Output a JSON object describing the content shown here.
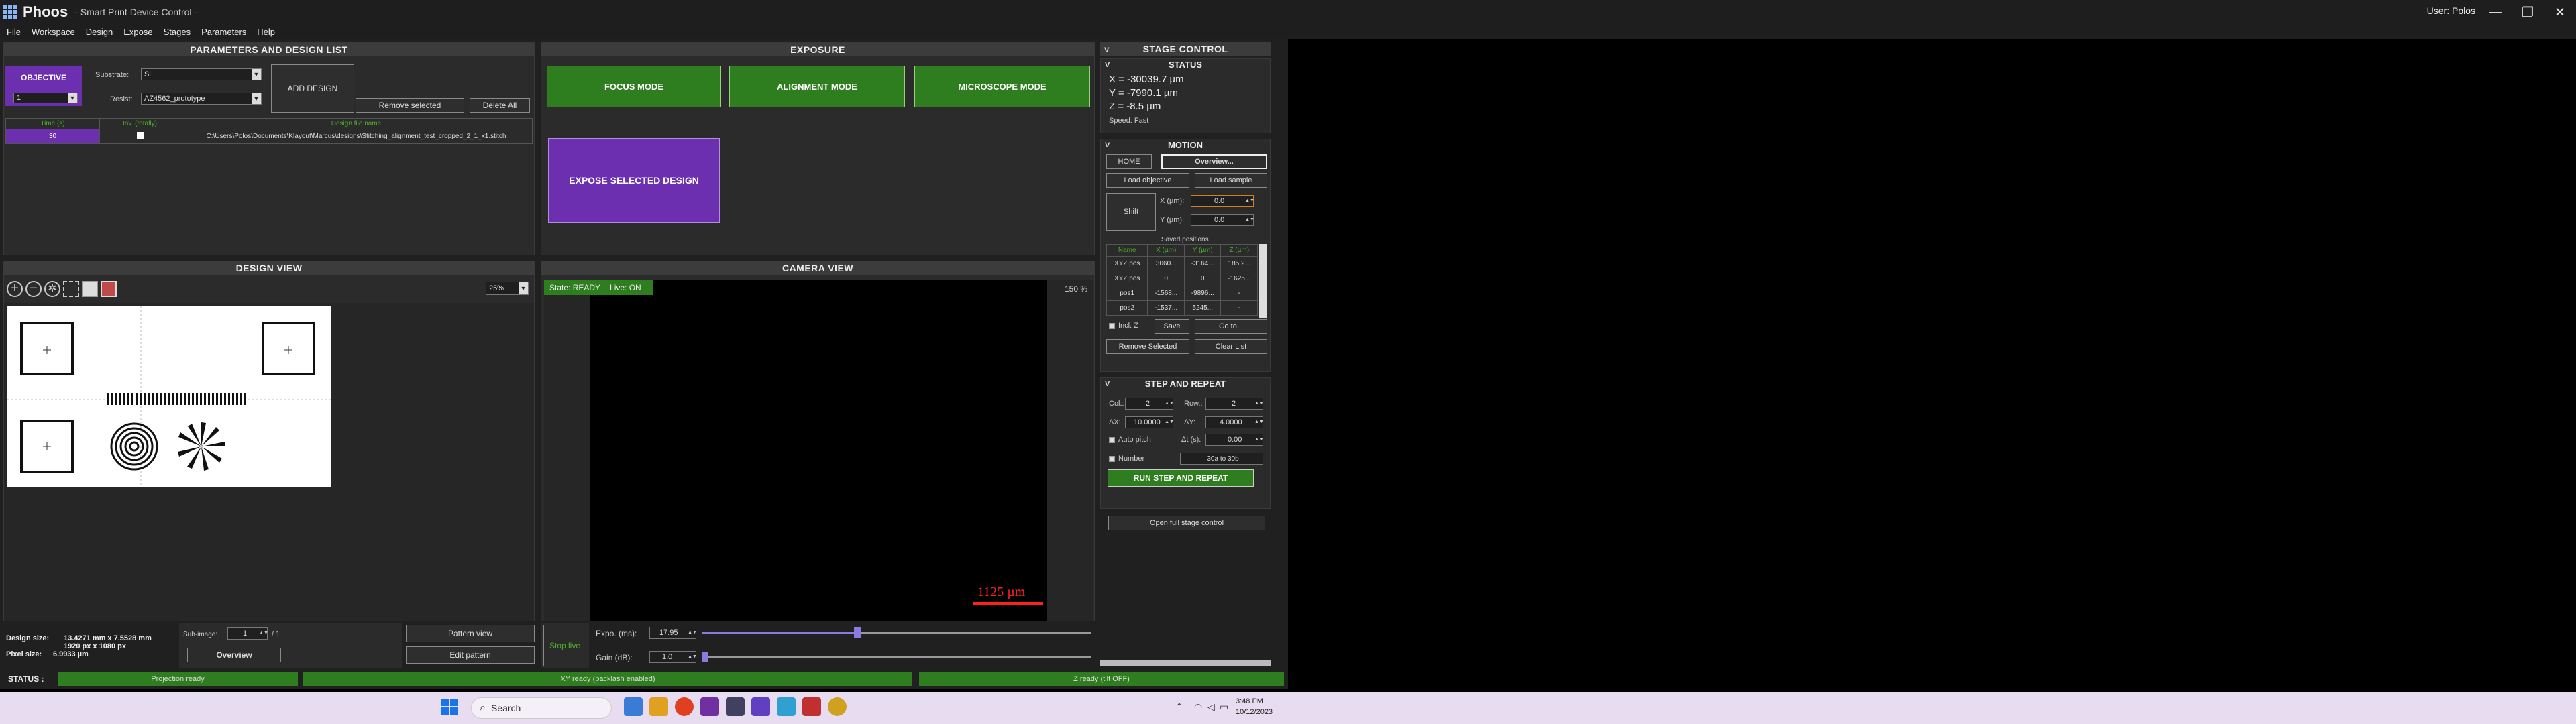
{
  "window": {
    "app_name": "Phoos",
    "subtitle": "- Smart Print Device Control -",
    "user": "User: Polos",
    "min": "—",
    "max": "❐",
    "close": "✕"
  },
  "menu": [
    "File",
    "Workspace",
    "Design",
    "Expose",
    "Stages",
    "Parameters",
    "Help"
  ],
  "params": {
    "title": "PARAMETERS AND DESIGN LIST",
    "objective_label": "OBJECTIVE",
    "objective_value": "1",
    "substrate_label": "Substrate:",
    "substrate_value": "Si",
    "resist_label": "Resist:",
    "resist_value": "AZ4562_prototype",
    "add_design": "ADD DESIGN",
    "remove_selected": "Remove selected",
    "delete_all": "Delete All",
    "columns": [
      "Time (s)",
      "Inv. (totally)",
      "Design file name"
    ],
    "row": {
      "time": "30",
      "file": "C:\\Users\\Polos\\Documents\\Klayout\\Marcus\\designs\\Stitching_alignment_test_cropped_2_1_x1.stitch"
    }
  },
  "exposure": {
    "title": "EXPOSURE",
    "focus": "FOCUS MODE",
    "alignment": "ALIGNMENT MODE",
    "microscope": "MICROSCOPE MODE",
    "expose": "EXPOSE SELECTED DESIGN"
  },
  "design_view": {
    "title": "DESIGN VIEW",
    "zoom": "25%",
    "size_label": "Design size:",
    "size_value": "13.4271 mm x 7.5528 mm",
    "px_value": "1920 px x 1080 px",
    "pixel_label": "Pixel size:",
    "pixel_value": "6.9933 µm",
    "subimage_label": "Sub-image:",
    "subimage_value": "1",
    "subimage_total": "/ 1",
    "overview": "Overview",
    "pattern_view": "Pattern view",
    "edit_pattern": "Edit pattern"
  },
  "camera": {
    "title": "CAMERA VIEW",
    "state": "State: READY",
    "live": "Live: ON",
    "zoom": "150 %",
    "scalebar": "1125 µm",
    "stop_live": "Stop live",
    "expo_label": "Expo. (ms):",
    "expo_value": "17.95",
    "expo_fraction": 0.4,
    "gain_label": "Gain (dB):",
    "gain_value": "1.0",
    "gain_fraction": 0.0
  },
  "stage": {
    "title": "STAGE CONTROL",
    "status_title": "STATUS",
    "x": "X = -30039.7 µm",
    "y": "Y = -7990.1 µm",
    "z": "Z = -8.5 µm",
    "speed": "Speed: Fast",
    "motion_title": "MOTION",
    "home": "HOME",
    "overview": "Overview...",
    "load_objective": "Load objective",
    "load_sample": "Load sample",
    "shift": "Shift",
    "xum": "X (µm):",
    "yum": "Y (µm):",
    "shift_x": "0.0",
    "shift_y": "0.0",
    "saved_title": "Saved positions",
    "saved_cols": [
      "Name",
      "X (µm)",
      "Y (µm)",
      "Z (µm)"
    ],
    "saved_rows": [
      [
        "XYZ pos",
        "3060...",
        "-3164...",
        "185.2..."
      ],
      [
        "XYZ pos",
        "0",
        "0",
        "-1625..."
      ],
      [
        "pos1",
        "-1568...",
        "-9896...",
        "-"
      ],
      [
        "pos2",
        "-1537...",
        "5245...",
        "-"
      ]
    ],
    "incl_z": "Incl. Z",
    "save": "Save",
    "goto": "Go to...",
    "remove_selected": "Remove Selected",
    "clear_list": "Clear List",
    "sr_title": "STEP AND REPEAT",
    "col_label": "Col.:",
    "col_value": "2",
    "row_label": "Row.:",
    "row_value": "2",
    "dx_label": "ΔX:",
    "dx_value": "10.0000",
    "dy_label": "ΔY:",
    "dy_value": "4.0000",
    "auto_pitch": "Auto pitch",
    "dt_label": "Δt (s):",
    "dt_value": "0.00",
    "number": "Number",
    "number_value": "30a to 30b",
    "run": "RUN STEP AND REPEAT",
    "open_full": "Open full stage control"
  },
  "status": {
    "label": "STATUS :",
    "projection": "Projection ready",
    "xy": "XY ready (backlash enabled)",
    "z": "Z ready (tilt OFF)"
  },
  "taskbar": {
    "search": "Search",
    "time": "3:48 PM",
    "date": "10/12/2023"
  },
  "colors": {
    "green": "#2e7d1e",
    "purple": "#6b2fb0",
    "panel": "#2b2b2b"
  }
}
